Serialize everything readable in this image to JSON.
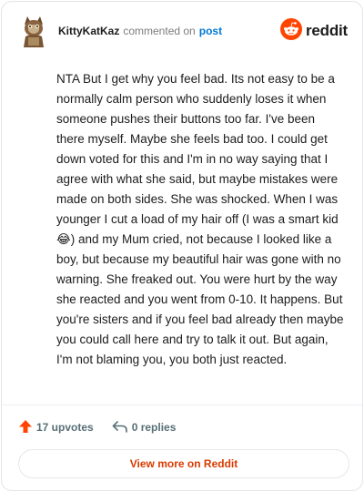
{
  "comment": {
    "username": "KittyKatKaz",
    "action": "commented on",
    "post_link": "post",
    "brand": "reddit",
    "body": "NTA But I get why you feel bad. Its not easy to be a normally calm person who suddenly loses it when someone pushes their buttons too far. I've been there myself. Maybe she feels bad too. I could get down voted for this and I'm in no way saying that I agree with what she said, but maybe mistakes were made on both sides. She was shocked. When I was younger I cut a load of my hair off (I was a smart kid 😂) and my Mum cried, not because I looked like a boy, but because my beautiful hair was gone with no warning. She freaked out. You were hurt by the way she reacted and you went from 0-10. It happens. But you're sisters and if you feel bad already then maybe you could call here and try to talk it out. But again, I'm not blaming you, you both just reacted."
  },
  "footer": {
    "upvotes": "17 upvotes",
    "replies": "0 replies"
  },
  "cta": {
    "label": "View more on Reddit"
  },
  "colors": {
    "reddit_orange": "#ff4500",
    "link_blue": "#0079d3",
    "cta_text": "#d93a00",
    "muted": "#576f76"
  },
  "icons": {
    "avatar": "cat-avatar",
    "brand": "reddit-logo-icon",
    "upvote": "upvote-arrow-icon",
    "reply": "reply-arrow-icon"
  }
}
